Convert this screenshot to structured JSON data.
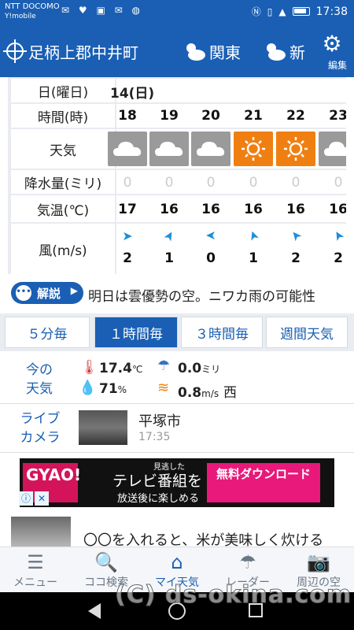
{
  "status_bar": {
    "carrier": "NTT DOCOMO",
    "carrier2": "Y!mobile",
    "time": "17:38"
  },
  "header": {
    "location": "足柄上郡中井町",
    "region": "関東",
    "region_next": "新",
    "settings_label": "編集"
  },
  "hourly": {
    "labels": {
      "date": "日(曜日)",
      "hour": "時間(時)",
      "weather": "天気",
      "rain": "降水量(ミリ)",
      "temp": "気温(℃)",
      "wind": "風(m/s)"
    },
    "date_value": "14(日)",
    "hours": [
      "18",
      "19",
      "20",
      "21",
      "22",
      "23"
    ],
    "weather": [
      "cloudy",
      "cloudy",
      "cloudy",
      "sunny",
      "sunny",
      "cloudy"
    ],
    "rain": [
      "0",
      "0",
      "0",
      "0",
      "0",
      "0"
    ],
    "temp": [
      "17",
      "16",
      "16",
      "16",
      "16",
      "16"
    ],
    "wind_speed": [
      "2",
      "1",
      "0",
      "1",
      "2",
      "2"
    ],
    "wind_glyph": [
      "➤",
      "➤",
      "➤",
      "➤",
      "➤",
      "➤"
    ]
  },
  "commentary": {
    "button": "解説",
    "text": "明日は雲優勢の空。ニワカ雨の可能性"
  },
  "tabs": [
    "５分毎",
    "１時間毎",
    "３時間毎",
    "週間天気"
  ],
  "now": {
    "label": "今の天気",
    "temp": "17.4",
    "temp_unit": "℃",
    "rain": "0.0",
    "rain_unit": "ミリ",
    "humidity": "71",
    "humidity_unit": "%",
    "wind": "0.8",
    "wind_unit": "m/s",
    "wind_dir": "西"
  },
  "live_camera": {
    "label": "ライブカメラ",
    "city": "平塚市",
    "time": "17:35"
  },
  "ad": {
    "logo": "GYAO!",
    "small": "見逃した",
    "main": "テレビ番組を",
    "sub": "放送後に楽しめる",
    "cta": "無料ダウンロード",
    "close": "✕"
  },
  "news": {
    "text": "〇〇を入れると、米が美味しく炊ける"
  },
  "bottom_nav": [
    {
      "label": "メニュー",
      "icon": "menu-icon",
      "glyph": "☰"
    },
    {
      "label": "ココ検索",
      "icon": "search-icon",
      "glyph": "🔍"
    },
    {
      "label": "マイ天気",
      "icon": "home-icon",
      "glyph": "⌂"
    },
    {
      "label": "レーダー",
      "icon": "umbrella-icon",
      "glyph": "☂"
    },
    {
      "label": "周辺の空",
      "icon": "camera-icon",
      "glyph": "📷"
    }
  ],
  "watermark": "(C) ds-okina.com",
  "colors": {
    "primary": "#1a5fb4",
    "cloud_cell": "#9a9a9a",
    "sun_cell": "#f07f11"
  }
}
